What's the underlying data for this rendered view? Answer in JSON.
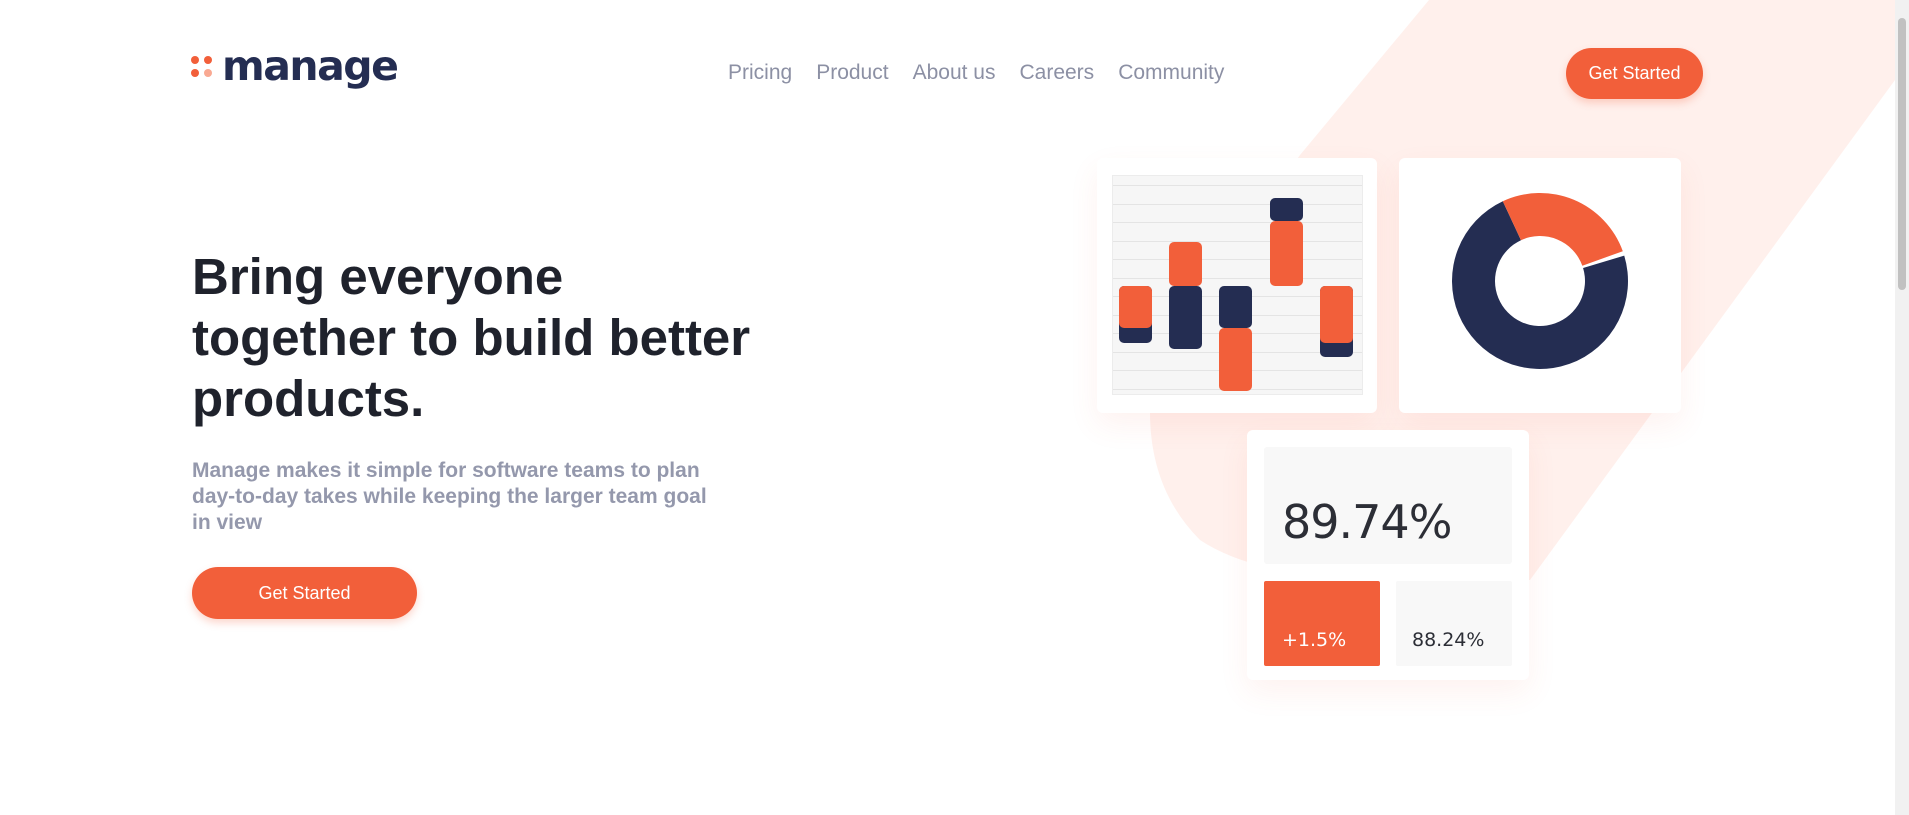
{
  "brand": {
    "name": "manage",
    "colors": {
      "accent": "#f25f3a",
      "accent_light": "#f9a992",
      "navy": "#242d52",
      "background_shape": "#fff0ec"
    }
  },
  "nav": {
    "items": [
      {
        "label": "Pricing"
      },
      {
        "label": "Product"
      },
      {
        "label": "About us"
      },
      {
        "label": "Careers"
      },
      {
        "label": "Community"
      }
    ],
    "cta_label": "Get Started"
  },
  "hero": {
    "title": "Bring everyone together to build better products.",
    "subtitle": "Manage makes it simple for software teams to plan day-to-day takes while keeping the larger team goal in view",
    "cta_label": "Get Started"
  },
  "illustration": {
    "bar_chart": {
      "bars": [
        {
          "segments": [
            {
              "color": "navy",
              "from": 0,
              "to": -1.35
            },
            {
              "color": "orange",
              "from": 0,
              "to": -1.0
            }
          ]
        },
        {
          "segments": [
            {
              "color": "orange",
              "from": 1.05,
              "to": 0
            },
            {
              "color": "navy",
              "from": 0,
              "to": -1.5
            }
          ]
        },
        {
          "segments": [
            {
              "color": "navy",
              "from": 0,
              "to": -1.0
            },
            {
              "color": "orange",
              "from": -1.0,
              "to": -2.5
            }
          ]
        },
        {
          "segments": [
            {
              "color": "navy",
              "from": 2.1,
              "to": 1.55
            },
            {
              "color": "orange",
              "from": 1.55,
              "to": 0
            }
          ]
        },
        {
          "segments": [
            {
              "color": "navy",
              "from": 0,
              "to": -1.7
            },
            {
              "color": "orange",
              "from": 0,
              "to": -1.35
            }
          ]
        }
      ]
    },
    "donut_chart": {
      "orange_share": 0.27,
      "navy_share": 0.73
    },
    "stats": {
      "main_value": "89.74%",
      "change": "+1.5%",
      "secondary_value": "88.24%"
    }
  }
}
